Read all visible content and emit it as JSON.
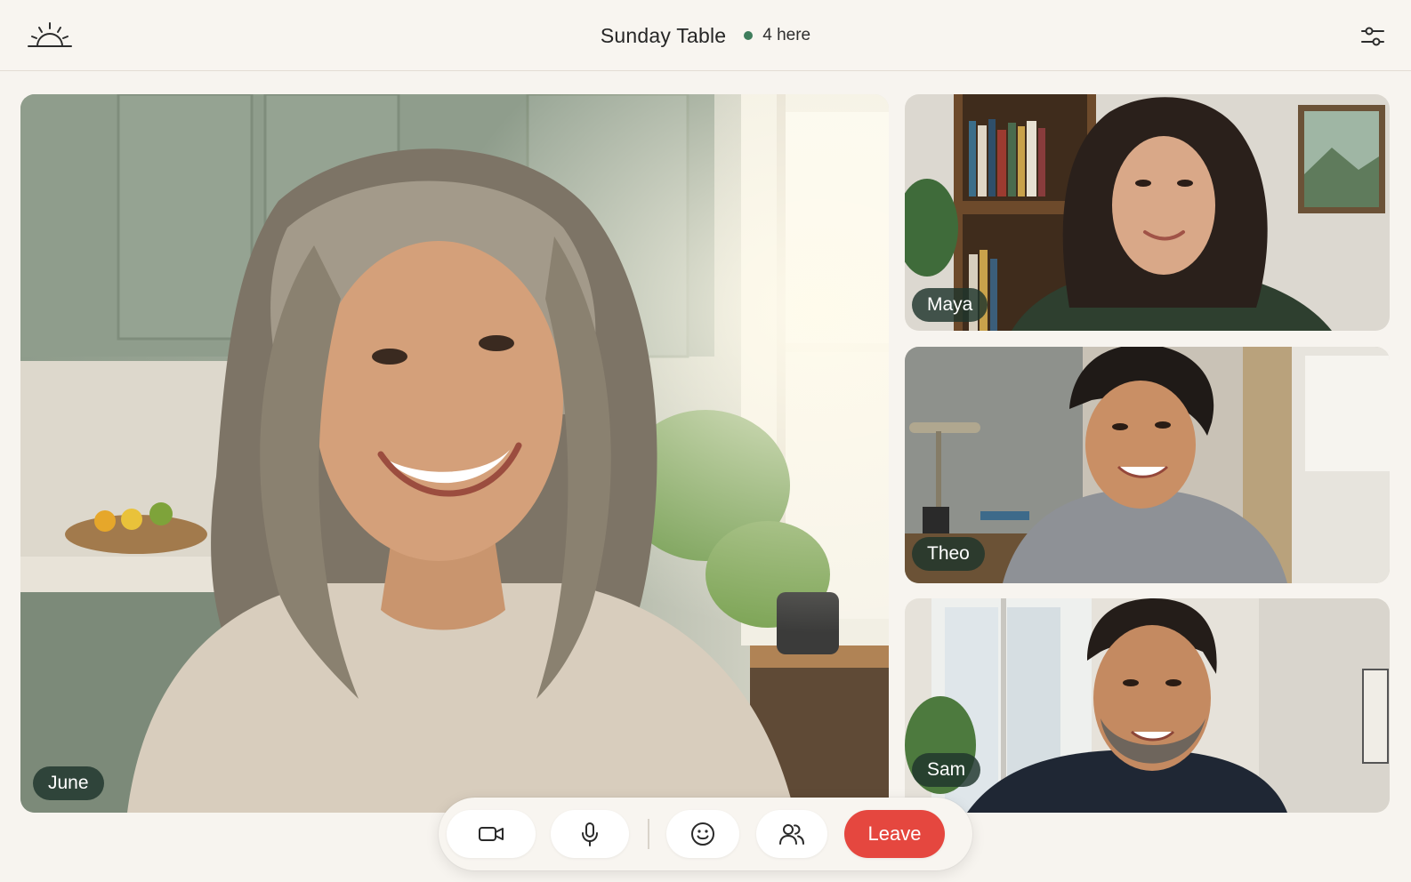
{
  "header": {
    "logo_icon": "sunrise-icon",
    "title": "Sunday Table",
    "presence": "4 here",
    "presence_color": "#3f7d5c",
    "settings_icon": "sliders-icon"
  },
  "participants": [
    {
      "name": "June",
      "role": "main-speaker"
    },
    {
      "name": "Maya"
    },
    {
      "name": "Theo"
    },
    {
      "name": "Sam"
    }
  ],
  "controls": {
    "camera_icon": "video-camera-icon",
    "mic_icon": "microphone-icon",
    "react_icon": "smiley-icon",
    "people_icon": "people-icon",
    "leave_label": "Leave",
    "leave_color": "#e5473f"
  },
  "colors": {
    "background": "#f7f4ef",
    "name_tag": "#1e342c"
  }
}
